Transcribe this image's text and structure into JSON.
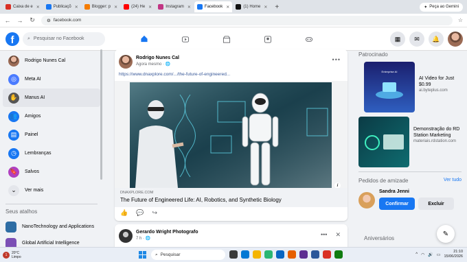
{
  "browser": {
    "tabs": [
      {
        "label": "Caixa de e",
        "color": "#d93025"
      },
      {
        "label": "Publicaçõ",
        "color": "#1877f2"
      },
      {
        "label": "Blogger: p",
        "color": "#f57c00"
      },
      {
        "label": "(24) He",
        "color": "#ff0000"
      },
      {
        "label": "Instagram",
        "color": "#c13584"
      },
      {
        "label": "Facebook",
        "color": "#1877f2"
      },
      {
        "label": "(1) Home",
        "color": "#111111"
      }
    ],
    "active_tab_index": 5,
    "gemini_label": "Peça ao Gemini",
    "url": "facebook.com"
  },
  "header": {
    "logo": "f",
    "search_placeholder": "Pesquisar no Facebook",
    "nav": [
      "home-icon",
      "video-icon",
      "marketplace-icon",
      "groups-icon",
      "gaming-icon"
    ],
    "active_nav": 0
  },
  "sidebar": {
    "items": [
      {
        "label": "Rodrigo Nunes Cal",
        "icon": "avatar",
        "color": "#8a5a44"
      },
      {
        "label": "Meta AI",
        "icon": "meta-ai-icon",
        "color": "#4a7bff"
      },
      {
        "label": "Manus AI",
        "icon": "hand-icon",
        "color": "#555555"
      },
      {
        "label": "Amigos",
        "icon": "friends-icon",
        "color": "#1877f2"
      },
      {
        "label": "Painel",
        "icon": "dashboard-icon",
        "color": "#1877f2"
      },
      {
        "label": "Lembranças",
        "icon": "clock-icon",
        "color": "#1877f2"
      },
      {
        "label": "Salvos",
        "icon": "bookmark-icon",
        "color": "#b040c0"
      },
      {
        "label": "Ver mais",
        "icon": "chevron-down-icon",
        "color": "#e4e6eb"
      }
    ],
    "highlighted_index": 2,
    "groups_heading": "Seus atalhos",
    "groups": [
      {
        "label": "NanoTechnology and Applications",
        "color": "#2e6da4"
      },
      {
        "label": "Global Artificial Intelligence",
        "color": "#7b4fb5"
      }
    ]
  },
  "post": {
    "author": "Rodrigo Nunes Cal",
    "meta": "Agora mesmo · 🌐",
    "link": "https://www.dnaxplore.com/.../the-future-of-engineered...",
    "domain": "DNAXPLORE.COM",
    "title": "The Future of Engineered Life: AI, Robotics, and Synthetic Biology",
    "info": "i"
  },
  "post2": {
    "author": "Gerardo Wright Photografo",
    "meta": "7 h · 🌐"
  },
  "right": {
    "sponsored_heading": "Patrocinado",
    "ads": [
      {
        "title": "AI Video for Just $0.99",
        "url": "ai.byteplus.com"
      },
      {
        "title": "Demonstração do RD Station Marketing",
        "url": "materiais.rdstation.com"
      }
    ],
    "requests_heading": "Pedidos de amizade",
    "requests_link": "Ver tudo",
    "request": {
      "name": "Sandra Jenni",
      "confirm": "Confirmar",
      "delete": "Excluir"
    },
    "birthdays_heading": "Aniversários"
  },
  "taskbar": {
    "weather_temp": "20°C",
    "weather_desc": "Limpo",
    "weather_badge": "1",
    "search_placeholder": "Pesquisar",
    "time": "21:10",
    "date": "15/06/2026"
  }
}
